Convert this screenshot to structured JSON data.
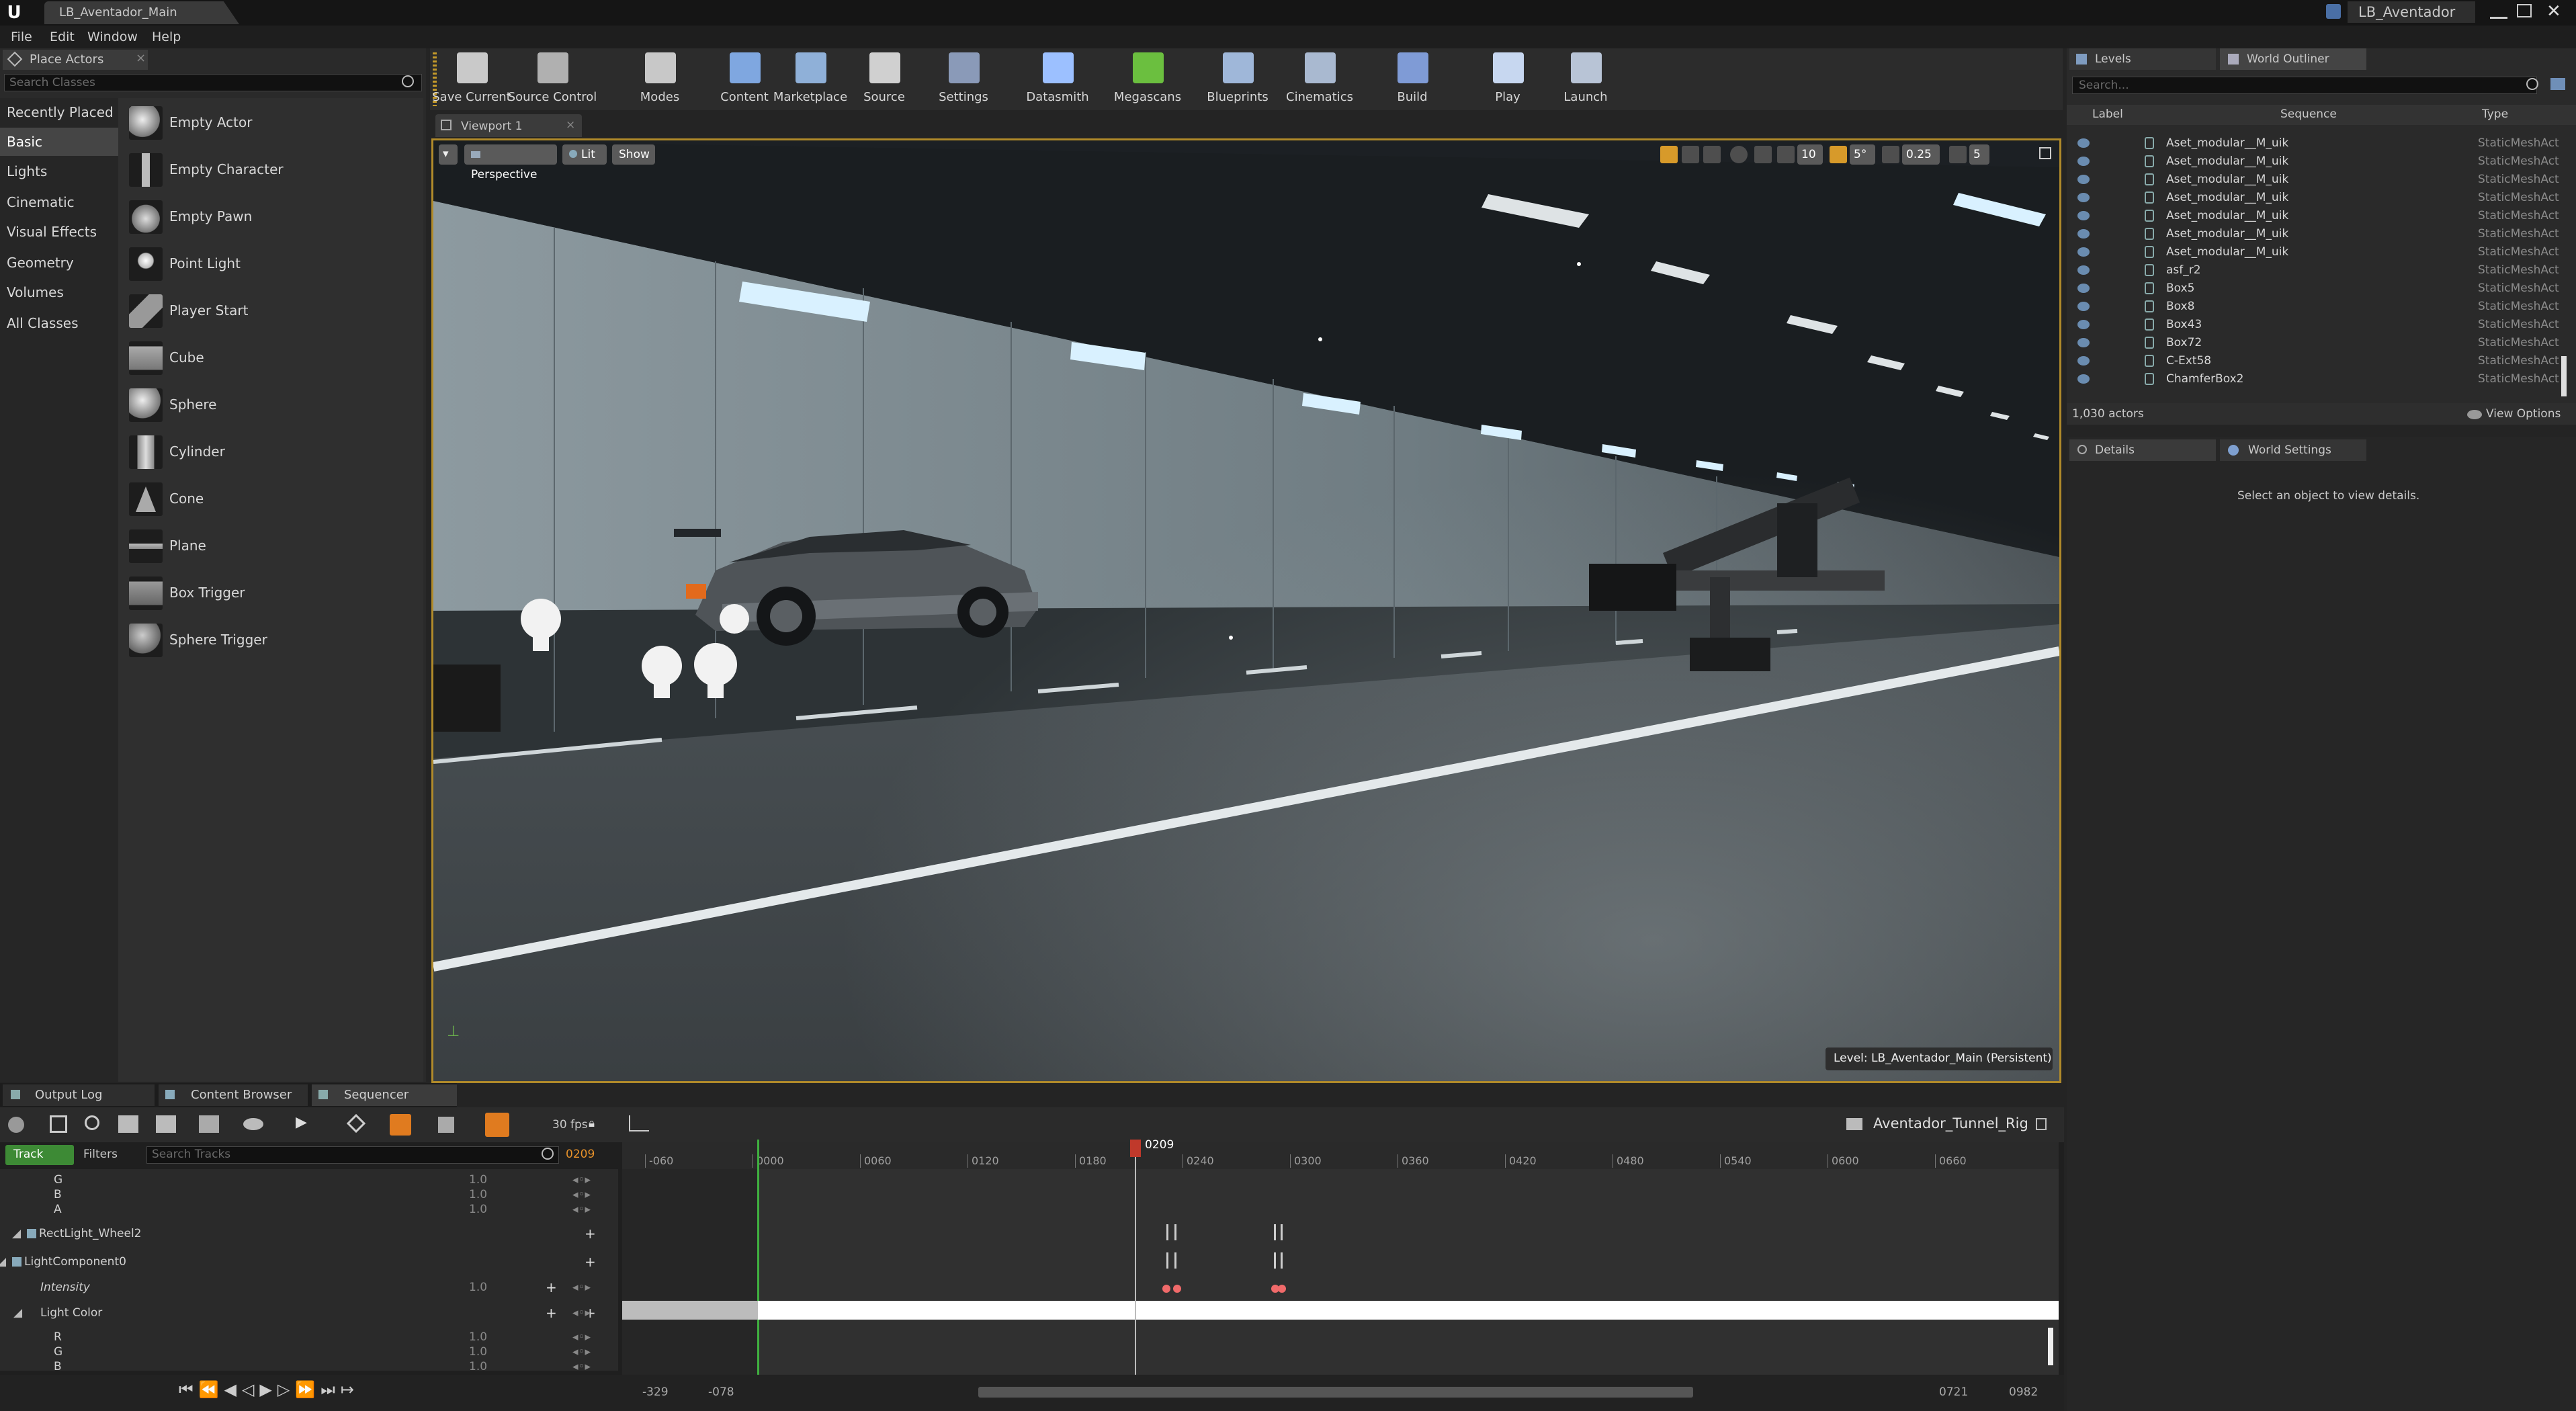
{
  "window": {
    "doc_tab": "LB_Aventador_Main",
    "project_name": "LB_Aventador",
    "menu": [
      "File",
      "Edit",
      "Window",
      "Help"
    ]
  },
  "place_actors": {
    "title": "Place Actors",
    "search_placeholder": "Search Classes",
    "categories": [
      "Recently Placed",
      "Basic",
      "Lights",
      "Cinematic",
      "Visual Effects",
      "Geometry",
      "Volumes",
      "All Classes"
    ],
    "selected_category": "Basic",
    "items": [
      "Empty Actor",
      "Empty Character",
      "Empty Pawn",
      "Point Light",
      "Player Start",
      "Cube",
      "Sphere",
      "Cylinder",
      "Cone",
      "Plane",
      "Box Trigger",
      "Sphere Trigger"
    ]
  },
  "toolbar": {
    "buttons": [
      {
        "label": "Save Current",
        "icon": "save-icon",
        "color": "#c9c9c9"
      },
      {
        "label": "Source Control",
        "icon": "source-control-icon",
        "color": "#b0b0b0"
      },
      {
        "label": "Modes",
        "icon": "modes-icon",
        "color": "#c8c8c8"
      },
      {
        "label": "Content",
        "icon": "content-icon",
        "color": "#7fa7e0"
      },
      {
        "label": "Marketplace",
        "icon": "marketplace-icon",
        "color": "#8fb0d8"
      },
      {
        "label": "Source",
        "icon": "source-icon",
        "color": "#d0d0d0"
      },
      {
        "label": "Settings",
        "icon": "settings-icon",
        "color": "#8a9ab8"
      },
      {
        "label": "Datasmith",
        "icon": "datasmith-icon",
        "color": "#9cc0ff"
      },
      {
        "label": "Megascans",
        "icon": "megascans-icon",
        "color": "#6bbf3f"
      },
      {
        "label": "Blueprints",
        "icon": "blueprints-icon",
        "color": "#9fb7d9"
      },
      {
        "label": "Cinematics",
        "icon": "cinematics-icon",
        "color": "#a9b9d0"
      },
      {
        "label": "Build",
        "icon": "build-icon",
        "color": "#7f9bd6"
      },
      {
        "label": "Play",
        "icon": "play-icon",
        "color": "#c7d7f0"
      },
      {
        "label": "Launch",
        "icon": "launch-icon",
        "color": "#b8c4d6"
      }
    ]
  },
  "viewport": {
    "tab": "Viewport 1",
    "perspective": "Perspective",
    "lit": "Lit",
    "show": "Show",
    "grid_snap": "10",
    "rot_snap": "5°",
    "scale_snap": "0.25",
    "cam_speed": "5",
    "level_label": "Level:  LB_Aventador_Main (Persistent)"
  },
  "outliner": {
    "tabs": [
      "Levels",
      "World Outliner"
    ],
    "search_placeholder": "Search...",
    "columns": [
      "Label",
      "Sequence",
      "Type"
    ],
    "rows": [
      {
        "label": "Aset_modular__M_uik",
        "type": "StaticMeshAct"
      },
      {
        "label": "Aset_modular__M_uik",
        "type": "StaticMeshAct"
      },
      {
        "label": "Aset_modular__M_uik",
        "type": "StaticMeshAct"
      },
      {
        "label": "Aset_modular__M_uik",
        "type": "StaticMeshAct"
      },
      {
        "label": "Aset_modular__M_uik",
        "type": "StaticMeshAct"
      },
      {
        "label": "Aset_modular__M_uik",
        "type": "StaticMeshAct"
      },
      {
        "label": "Aset_modular__M_uik",
        "type": "StaticMeshAct"
      },
      {
        "label": "asf_r2",
        "type": "StaticMeshAct"
      },
      {
        "label": "Box5",
        "type": "StaticMeshAct"
      },
      {
        "label": "Box8",
        "type": "StaticMeshAct"
      },
      {
        "label": "Box43",
        "type": "StaticMeshAct"
      },
      {
        "label": "Box72",
        "type": "StaticMeshAct"
      },
      {
        "label": "C-Ext58",
        "type": "StaticMeshAct"
      },
      {
        "label": "ChamferBox2",
        "type": "StaticMeshAct"
      }
    ],
    "actor_count": "1,030 actors",
    "view_options": "View Options"
  },
  "details": {
    "tabs": [
      "Details",
      "World Settings"
    ],
    "empty_message": "Select an object to view details."
  },
  "bottom_tabs": [
    "Output Log",
    "Content Browser",
    "Sequencer"
  ],
  "sequencer": {
    "fps": "30 fps",
    "track_button": "Track",
    "filters": "Filters",
    "search_placeholder": "Search Tracks",
    "current_frame": "0209",
    "sequence_name": "Aventador_Tunnel_Rig",
    "tracks": [
      {
        "name": "G",
        "value": "1.0",
        "indent": 3
      },
      {
        "name": "B",
        "value": "1.0",
        "indent": 3
      },
      {
        "name": "A",
        "value": "1.0",
        "indent": 3
      },
      {
        "name": "RectLight_Wheel2",
        "value": "",
        "indent": 0
      },
      {
        "name": "LightComponent0",
        "value": "",
        "indent": 1
      },
      {
        "name": "Intensity",
        "value": "1.0",
        "indent": 2
      },
      {
        "name": "Light Color",
        "value": "",
        "indent": 2
      },
      {
        "name": "R",
        "value": "1.0",
        "indent": 3
      },
      {
        "name": "G",
        "value": "1.0",
        "indent": 3
      },
      {
        "name": "B",
        "value": "1.0",
        "indent": 3
      }
    ],
    "ticks": [
      "-060",
      "0000",
      "0060",
      "0120",
      "0180",
      "0240",
      "0300",
      "0360",
      "0420",
      "0480",
      "0540",
      "0600",
      "0660"
    ],
    "range_start": "-329",
    "range_view_start": "-078",
    "range_view_end": "0721",
    "range_end": "0982"
  }
}
